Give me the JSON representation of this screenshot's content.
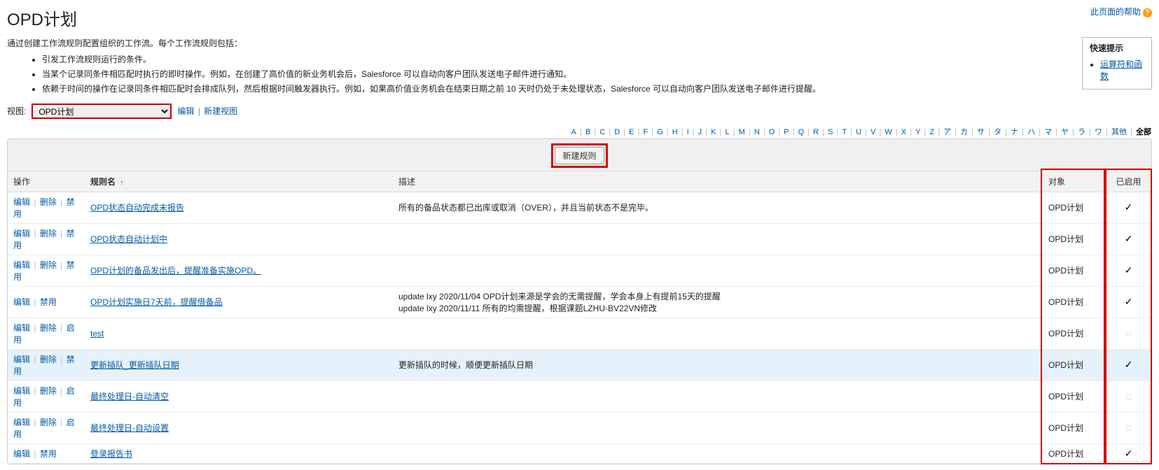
{
  "page_title": "OPD计划",
  "help_link": "此页面的帮助",
  "intro_line": "通过创建工作流规则配置组织的工作流。每个工作流规则包括：",
  "intro_bullets": [
    "引发工作流规则运行的条件。",
    "当某个记录同条件相匹配时执行的即时操作。例如，在创建了高价值的新业务机会后，Salesforce 可以自动向客户团队发送电子邮件进行通知。",
    "依赖于时间的操作在记录同条件相匹配时会排成队列，然后根据时间触发器执行。例如，如果高价值业务机会在结束日期之前 10 天时仍处于未处理状态，Salesforce 可以自动向客户团队发送电子邮件进行提醒。"
  ],
  "tips_title": "快速提示",
  "tips_link": "运算符和函数",
  "view_label": "视图:",
  "view_selected": "OPD计划",
  "view_edit": "编辑",
  "view_new": "新建视图",
  "alpha": [
    "A",
    "B",
    "C",
    "D",
    "E",
    "F",
    "G",
    "H",
    "I",
    "J",
    "K",
    "L",
    "M",
    "N",
    "O",
    "P",
    "Q",
    "R",
    "S",
    "T",
    "U",
    "V",
    "W",
    "X",
    "Y",
    "Z",
    "ア",
    "カ",
    "サ",
    "タ",
    "ナ",
    "ハ",
    "マ",
    "ヤ",
    "ラ",
    "ワ",
    "其他",
    "全部"
  ],
  "new_rule_btn": "新建规则",
  "columns": {
    "action": "操作",
    "rule_name": "规则名",
    "description": "描述",
    "object": "对象",
    "enabled": "已启用"
  },
  "sort_indicator": "↑",
  "act_labels": {
    "edit": "编辑",
    "delete": "删除",
    "disable": "禁用",
    "enable": "启用"
  },
  "rows": [
    {
      "actions": [
        "edit",
        "delete",
        "disable"
      ],
      "rule_name": "OPD状态自动完成末报告",
      "description": "所有的备品状态都已出库或取消（OVER），并且当前状态不是完毕。",
      "object": "OPD计划",
      "enabled": true
    },
    {
      "actions": [
        "edit",
        "delete",
        "disable"
      ],
      "rule_name": "OPD状态自动计划中",
      "description": "",
      "object": "OPD计划",
      "enabled": true
    },
    {
      "actions": [
        "edit",
        "delete",
        "disable"
      ],
      "rule_name": "OPD计划的备品发出后，提醒准备实施OPD。",
      "description": "",
      "object": "OPD计划",
      "enabled": true
    },
    {
      "actions": [
        "edit",
        "disable"
      ],
      "rule_name": "OPD计划实施日7天前，提醒借备品",
      "description": "update lxy 2020/11/04 OPD计划来源是学会的无需提醒，学会本身上有提前15天的提醒\nupdate lxy 2020/11/11 所有的均需提醒，根据课题LZHU-BV22VN修改",
      "object": "OPD计划",
      "enabled": true
    },
    {
      "actions": [
        "edit",
        "delete",
        "enable"
      ],
      "rule_name": "test",
      "description": "",
      "object": "OPD计划",
      "enabled": false
    },
    {
      "actions": [
        "edit",
        "delete",
        "disable"
      ],
      "rule_name": "更新插队_更新插队日期",
      "description": "更新插队的时候，顺便更新插队日期",
      "object": "OPD计划",
      "enabled": true,
      "hover": true
    },
    {
      "actions": [
        "edit",
        "delete",
        "enable"
      ],
      "rule_name": "最终处理日-自动清空",
      "description": "",
      "object": "OPD计划",
      "enabled": false
    },
    {
      "actions": [
        "edit",
        "delete",
        "enable"
      ],
      "rule_name": "最终处理日-自动设置",
      "description": "",
      "object": "OPD计划",
      "enabled": false
    },
    {
      "actions": [
        "edit",
        "disable"
      ],
      "rule_name": "登录报告书",
      "description": "",
      "object": "OPD计划",
      "enabled": true
    }
  ]
}
